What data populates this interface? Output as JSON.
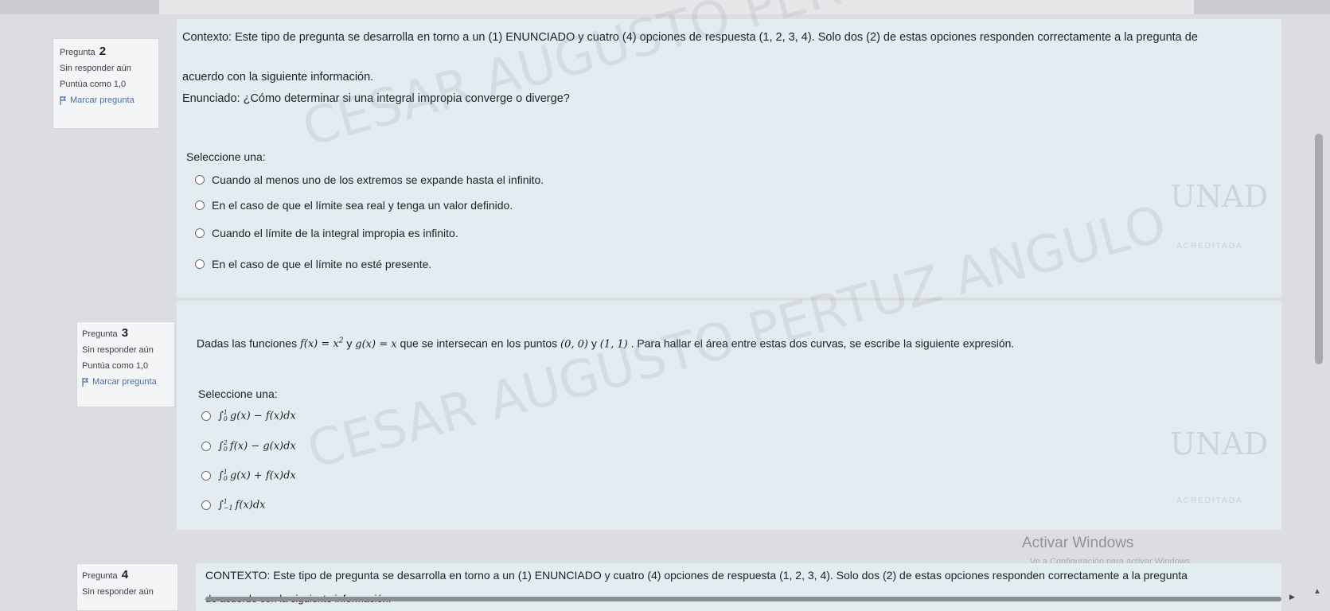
{
  "questions": [
    {
      "number_label": "Pregunta",
      "number": "2",
      "status": "Sin responder aún",
      "points": "Puntúa como 1,0",
      "flag_label": "Marcar pregunta",
      "text_lines": [
        "Contexto: Este tipo de pregunta se desarrolla en torno a un (1) ENUNCIADO y cuatro (4) opciones de respuesta (1, 2, 3, 4). Solo dos (2) de estas opciones responden correctamente a la pregunta de",
        "acuerdo con la siguiente información.",
        "Enunciado: ¿Cómo determinar si una integral impropia converge o diverge?"
      ],
      "prompt": "Seleccione una:",
      "options": [
        "Cuando al menos uno de los extremos se expande hasta el infinito.",
        "En el caso de que el límite sea real y tenga un valor definido.",
        "Cuando el límite de la integral impropia es infinito.",
        "En el caso de que el límite no esté presente."
      ]
    },
    {
      "number_label": "Pregunta",
      "number": "3",
      "status": "Sin responder aún",
      "points": "Puntúa como 1,0",
      "flag_label": "Marcar pregunta",
      "text_parts": {
        "a": "Dadas las funciones",
        "f": "f(x) = x",
        "f_exp": "2",
        "y1": "y",
        "g": "g(x) = x",
        "b": "que se intersecan en los puntos",
        "p1": "(0, 0)",
        "y2": "y",
        "p2": "(1, 1)",
        "c": ". Para hallar el área entre estas dos curvas, se escribe la siguiente expresión."
      },
      "prompt": "Seleccione una:",
      "options": [
        {
          "int": "∫",
          "up": "1",
          "lo": "0",
          "expr": "g(x) − f(x)dx"
        },
        {
          "int": "∫",
          "up": "2",
          "lo": "0",
          "expr": "f(x) − g(x)dx"
        },
        {
          "int": "∫",
          "up": "1",
          "lo": "0",
          "expr": "g(x) + f(x)dx"
        },
        {
          "int": "∫",
          "up": "1",
          "lo": "−1",
          "expr": "f(x)dx"
        }
      ]
    },
    {
      "number_label": "Pregunta",
      "number": "4",
      "status": "Sin responder aún",
      "text_lines": [
        "CONTEXTO: Este tipo de pregunta se desarrolla en torno a un (1) ENUNCIADO y cuatro (4) opciones de respuesta (1, 2, 3, 4). Solo dos (2) de estas opciones responden correctamente a la pregunta",
        "de acuerdo con la siguiente información."
      ]
    }
  ],
  "watermark": {
    "line1": "CESAR AUGUSTO PERTUZ ANGULO",
    "line2_part": "PERTUZ ANGULO"
  },
  "logo": {
    "unad": "UNAD",
    "acreditada": "ACREDITADA"
  },
  "windows": {
    "title": "Activar Windows",
    "subtitle": "Ve a Configuración para activar Windows."
  },
  "colors": {
    "content_bg": "#e3ecf0",
    "info_bg": "#f4f5f6",
    "flag": "#4a6fa5"
  }
}
